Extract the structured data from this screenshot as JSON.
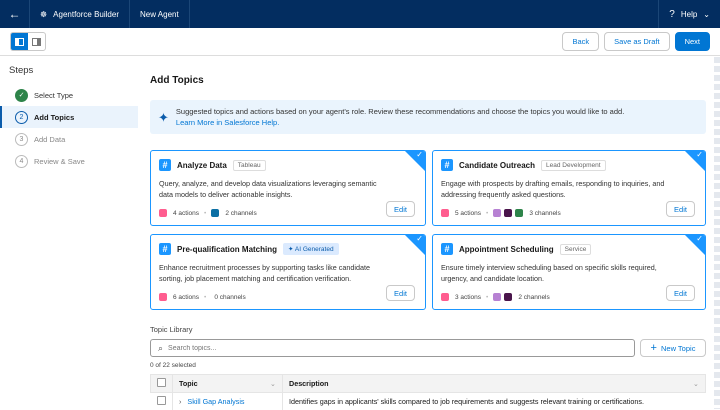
{
  "header": {
    "app_name": "Agentforce Builder",
    "tab": "New Agent",
    "help": "Help"
  },
  "toolbar": {
    "back": "Back",
    "save_draft": "Save as Draft",
    "next": "Next"
  },
  "steps": {
    "title": "Steps",
    "items": [
      {
        "num": "✓",
        "label": "Select Type",
        "state": "done"
      },
      {
        "num": "2",
        "label": "Add Topics",
        "state": "active"
      },
      {
        "num": "3",
        "label": "Add Data",
        "state": "pending"
      },
      {
        "num": "4",
        "label": "Review & Save",
        "state": "pending"
      }
    ]
  },
  "main": {
    "title": "Add Topics",
    "banner": {
      "text": "Suggested topics and actions based on your agent's role. Review these recommendations and choose the topics you would like to add.",
      "link": "Learn More in Salesforce Help."
    },
    "cards": [
      {
        "name": "Analyze Data",
        "tag": "Tableau",
        "desc": "Query, analyze, and develop data visualizations leveraging semantic data models to deliver actionable insights.",
        "actions": "4 actions",
        "channels": "2 channels",
        "channel_colors": [
          "#0b6fa4"
        ],
        "selected": true
      },
      {
        "name": "Candidate Outreach",
        "tag": "Lead Development",
        "desc": "Engage with prospects by drafting emails, responding to inquiries, and addressing frequently asked questions.",
        "actions": "5 actions",
        "channels": "3 channels",
        "channel_colors": [
          "#b781d3",
          "#4a154b",
          "#2e844a"
        ],
        "selected": true
      },
      {
        "name": "Pre-qualification Matching",
        "tag": "✦ AI Generated",
        "desc": "Enhance recruitment processes by supporting tasks like candidate sorting, job placement matching and certification verification.",
        "actions": "6 actions",
        "channels": "0 channels",
        "channel_colors": [],
        "selected": true
      },
      {
        "name": "Appointment Scheduling",
        "tag": "Service",
        "desc": "Ensure timely interview scheduling based on specific skills required, urgency, and candidate location.",
        "actions": "3 actions",
        "channels": "2 channels",
        "channel_colors": [
          "#b781d3",
          "#4a154b"
        ],
        "selected": true
      }
    ],
    "edit": "Edit",
    "library": {
      "title": "Topic Library",
      "search_placeholder": "Search topics...",
      "new_topic": "New Topic",
      "count": "0 of 22 selected",
      "columns": [
        "Topic",
        "Description"
      ],
      "rows": [
        {
          "topic": "Skill Gap Analysis",
          "description": "Identifies gaps in applicants' skills compared to job requirements and suggests relevant training or certifications."
        }
      ]
    }
  },
  "colors": {
    "nav": "#032d60",
    "brand": "#0176d3",
    "action_icon": "#ff5d8f"
  }
}
